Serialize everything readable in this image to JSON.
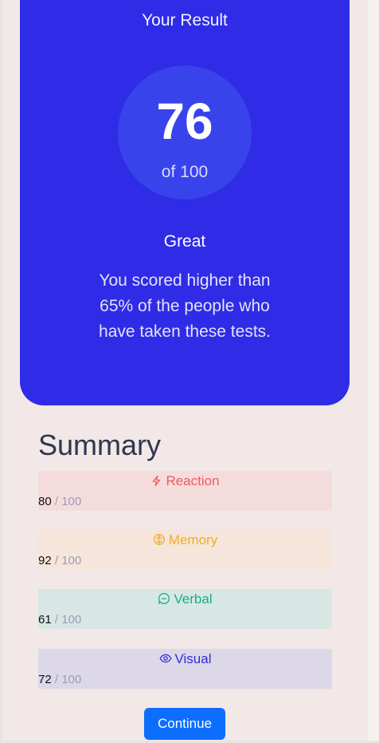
{
  "result": {
    "title": "Your Result",
    "score": "76",
    "score_of": "of 100",
    "grade": "Great",
    "description": "You scored higher than 65% of the people who have taken these tests."
  },
  "summary": {
    "title": "Summary",
    "max_label": " / 100",
    "items": [
      {
        "label": "Reaction",
        "score": "80",
        "icon": "lightning-icon",
        "color": "#f25a5c",
        "bg": "#f4dcdd"
      },
      {
        "label": "Memory",
        "score": "92",
        "icon": "brain-icon",
        "color": "#f4ad24",
        "bg": "#f5e5da"
      },
      {
        "label": "Verbal",
        "score": "61",
        "icon": "speech-bubble-icon",
        "color": "#17ae86",
        "bg": "#d8e7e4"
      },
      {
        "label": "Visual",
        "score": "72",
        "icon": "eye-icon",
        "color": "#2f2ce0",
        "bg": "#dcd8e8"
      }
    ]
  },
  "actions": {
    "continue_label": "Continue"
  },
  "colors": {
    "accent": "#2f2be6",
    "button": "#0d6efd"
  }
}
